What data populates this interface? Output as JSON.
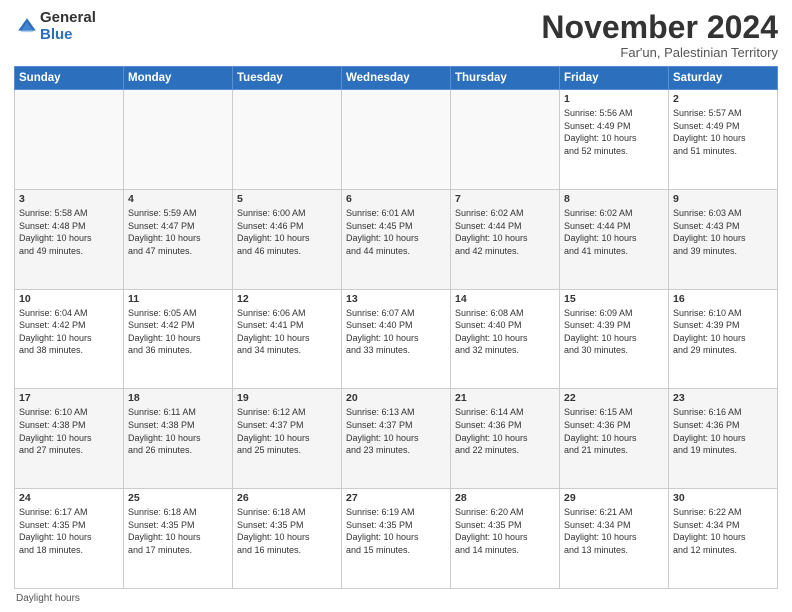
{
  "logo": {
    "general": "General",
    "blue": "Blue"
  },
  "header": {
    "month": "November 2024",
    "location": "Far'un, Palestinian Territory"
  },
  "days_of_week": [
    "Sunday",
    "Monday",
    "Tuesday",
    "Wednesday",
    "Thursday",
    "Friday",
    "Saturday"
  ],
  "weeks": [
    [
      {
        "day": "",
        "info": ""
      },
      {
        "day": "",
        "info": ""
      },
      {
        "day": "",
        "info": ""
      },
      {
        "day": "",
        "info": ""
      },
      {
        "day": "",
        "info": ""
      },
      {
        "day": "1",
        "info": "Sunrise: 5:56 AM\nSunset: 4:49 PM\nDaylight: 10 hours\nand 52 minutes."
      },
      {
        "day": "2",
        "info": "Sunrise: 5:57 AM\nSunset: 4:49 PM\nDaylight: 10 hours\nand 51 minutes."
      }
    ],
    [
      {
        "day": "3",
        "info": "Sunrise: 5:58 AM\nSunset: 4:48 PM\nDaylight: 10 hours\nand 49 minutes."
      },
      {
        "day": "4",
        "info": "Sunrise: 5:59 AM\nSunset: 4:47 PM\nDaylight: 10 hours\nand 47 minutes."
      },
      {
        "day": "5",
        "info": "Sunrise: 6:00 AM\nSunset: 4:46 PM\nDaylight: 10 hours\nand 46 minutes."
      },
      {
        "day": "6",
        "info": "Sunrise: 6:01 AM\nSunset: 4:45 PM\nDaylight: 10 hours\nand 44 minutes."
      },
      {
        "day": "7",
        "info": "Sunrise: 6:02 AM\nSunset: 4:44 PM\nDaylight: 10 hours\nand 42 minutes."
      },
      {
        "day": "8",
        "info": "Sunrise: 6:02 AM\nSunset: 4:44 PM\nDaylight: 10 hours\nand 41 minutes."
      },
      {
        "day": "9",
        "info": "Sunrise: 6:03 AM\nSunset: 4:43 PM\nDaylight: 10 hours\nand 39 minutes."
      }
    ],
    [
      {
        "day": "10",
        "info": "Sunrise: 6:04 AM\nSunset: 4:42 PM\nDaylight: 10 hours\nand 38 minutes."
      },
      {
        "day": "11",
        "info": "Sunrise: 6:05 AM\nSunset: 4:42 PM\nDaylight: 10 hours\nand 36 minutes."
      },
      {
        "day": "12",
        "info": "Sunrise: 6:06 AM\nSunset: 4:41 PM\nDaylight: 10 hours\nand 34 minutes."
      },
      {
        "day": "13",
        "info": "Sunrise: 6:07 AM\nSunset: 4:40 PM\nDaylight: 10 hours\nand 33 minutes."
      },
      {
        "day": "14",
        "info": "Sunrise: 6:08 AM\nSunset: 4:40 PM\nDaylight: 10 hours\nand 32 minutes."
      },
      {
        "day": "15",
        "info": "Sunrise: 6:09 AM\nSunset: 4:39 PM\nDaylight: 10 hours\nand 30 minutes."
      },
      {
        "day": "16",
        "info": "Sunrise: 6:10 AM\nSunset: 4:39 PM\nDaylight: 10 hours\nand 29 minutes."
      }
    ],
    [
      {
        "day": "17",
        "info": "Sunrise: 6:10 AM\nSunset: 4:38 PM\nDaylight: 10 hours\nand 27 minutes."
      },
      {
        "day": "18",
        "info": "Sunrise: 6:11 AM\nSunset: 4:38 PM\nDaylight: 10 hours\nand 26 minutes."
      },
      {
        "day": "19",
        "info": "Sunrise: 6:12 AM\nSunset: 4:37 PM\nDaylight: 10 hours\nand 25 minutes."
      },
      {
        "day": "20",
        "info": "Sunrise: 6:13 AM\nSunset: 4:37 PM\nDaylight: 10 hours\nand 23 minutes."
      },
      {
        "day": "21",
        "info": "Sunrise: 6:14 AM\nSunset: 4:36 PM\nDaylight: 10 hours\nand 22 minutes."
      },
      {
        "day": "22",
        "info": "Sunrise: 6:15 AM\nSunset: 4:36 PM\nDaylight: 10 hours\nand 21 minutes."
      },
      {
        "day": "23",
        "info": "Sunrise: 6:16 AM\nSunset: 4:36 PM\nDaylight: 10 hours\nand 19 minutes."
      }
    ],
    [
      {
        "day": "24",
        "info": "Sunrise: 6:17 AM\nSunset: 4:35 PM\nDaylight: 10 hours\nand 18 minutes."
      },
      {
        "day": "25",
        "info": "Sunrise: 6:18 AM\nSunset: 4:35 PM\nDaylight: 10 hours\nand 17 minutes."
      },
      {
        "day": "26",
        "info": "Sunrise: 6:18 AM\nSunset: 4:35 PM\nDaylight: 10 hours\nand 16 minutes."
      },
      {
        "day": "27",
        "info": "Sunrise: 6:19 AM\nSunset: 4:35 PM\nDaylight: 10 hours\nand 15 minutes."
      },
      {
        "day": "28",
        "info": "Sunrise: 6:20 AM\nSunset: 4:35 PM\nDaylight: 10 hours\nand 14 minutes."
      },
      {
        "day": "29",
        "info": "Sunrise: 6:21 AM\nSunset: 4:34 PM\nDaylight: 10 hours\nand 13 minutes."
      },
      {
        "day": "30",
        "info": "Sunrise: 6:22 AM\nSunset: 4:34 PM\nDaylight: 10 hours\nand 12 minutes."
      }
    ]
  ],
  "footer": "Daylight hours"
}
